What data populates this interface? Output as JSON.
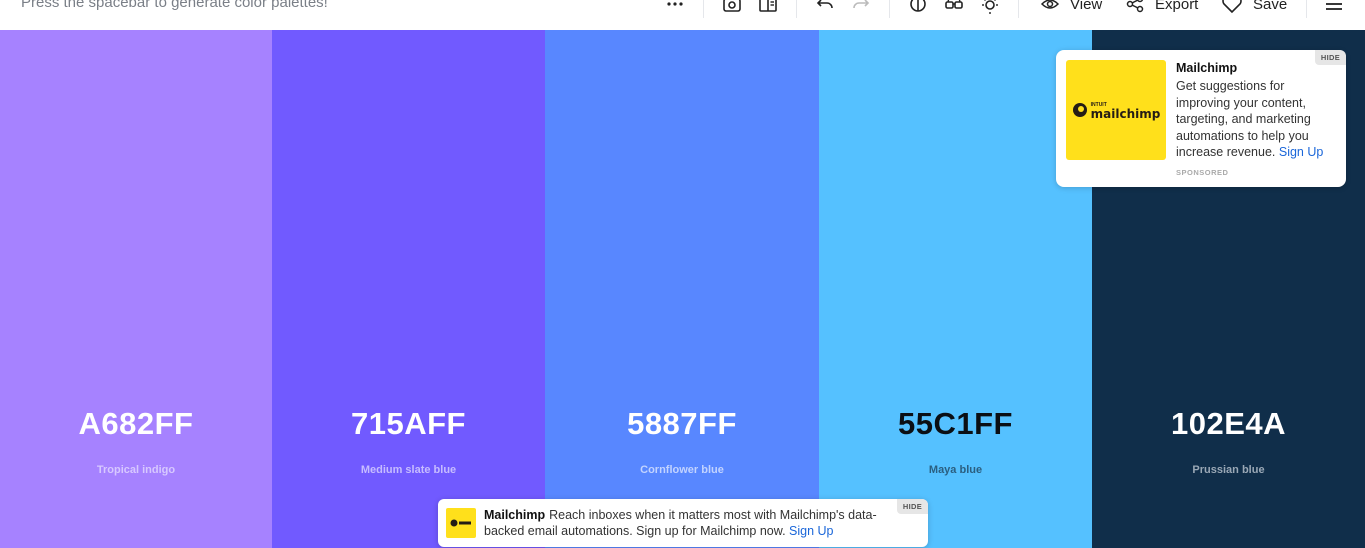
{
  "toolbar": {
    "hint": "Press the spacebar to generate color palettes!",
    "view_label": "View",
    "export_label": "Export",
    "save_label": "Save"
  },
  "palette": [
    {
      "hex": "A682FF",
      "name": "Tropical indigo",
      "bg": "#a682ff",
      "text_color": "#ffffff",
      "name_color": "#d7c8ff"
    },
    {
      "hex": "715AFF",
      "name": "Medium slate blue",
      "bg": "#715aff",
      "text_color": "#ffffff",
      "name_color": "#c6bcff"
    },
    {
      "hex": "5887FF",
      "name": "Cornflower blue",
      "bg": "#5887ff",
      "text_color": "#ffffff",
      "name_color": "#c2d3ff"
    },
    {
      "hex": "55C1FF",
      "name": "Maya blue",
      "bg": "#55c1ff",
      "text_color": "#0b0f14",
      "name_color": "#2b5f80"
    },
    {
      "hex": "102E4A",
      "name": "Prussian blue",
      "bg": "#102e4a",
      "text_color": "#ffffff",
      "name_color": "#9aa8b6"
    }
  ],
  "ad_card": {
    "logo_text": "mailchimp",
    "logo_small": "INTUIT",
    "title": "Mailchimp",
    "body": "Get suggestions for improving your content, targeting, and marketing automations to help you increase revenue.",
    "link": "Sign Up",
    "sponsored": "SPONSORED",
    "hide": "HIDE"
  },
  "banner": {
    "title": "Mailchimp",
    "body": "Reach inboxes when it matters most with Mailchimp's data-backed email automations. Sign up for Mailchimp now.",
    "link": "Sign Up",
    "hide": "HIDE"
  }
}
